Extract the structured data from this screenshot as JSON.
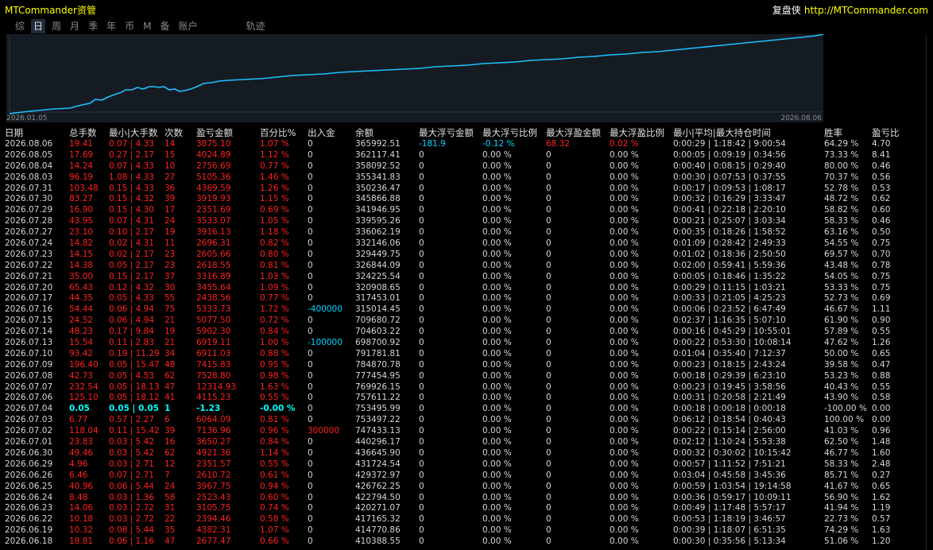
{
  "app_title": "MTCommander资管",
  "brand": {
    "name": "复盘侠",
    "url": "http://MTCommander.com"
  },
  "tabs": [
    "综",
    "日",
    "周",
    "月",
    "季",
    "年",
    "币",
    "M",
    "备",
    "账户",
    "轨迹"
  ],
  "active_tab": "日",
  "equity_chart": {
    "start_label": "2026.01.05",
    "end_label": "2026.08.06",
    "line_color": "#1ec0ff",
    "background": "#151b22"
  },
  "columns": [
    "日期",
    "总手数",
    "最小|大手数",
    "次数",
    "盈亏金额",
    "百分比%",
    "出入金",
    "余额",
    "最大浮亏金额",
    "最大浮亏比例",
    "最大浮盈金额",
    "最大浮盈比例",
    "最小|平均|最大持仓时间",
    "胜率",
    "盈亏比"
  ],
  "rows": [
    [
      "2026.08.06",
      "19.41",
      "0.07 | 4.33",
      "14",
      "3875.10",
      "1.07 %",
      "0",
      "365992.51",
      "-181.9",
      "-0.12 %",
      "68.32",
      "0.02 %",
      "0:00:29 | 1:18:42 | 9:00:54",
      "64.29 %",
      "4.70"
    ],
    [
      "2026.08.05",
      "17.69",
      "0.27 | 2.17",
      "15",
      "4024.89",
      "1.12 %",
      "0",
      "362117.41",
      "0",
      "0.00 %",
      "0",
      "0.00 %",
      "0:00:05 | 0:09:19 | 0:34:56",
      "73.33 %",
      "8.41"
    ],
    [
      "2026.08.04",
      "14.24",
      "0.07 | 4.33",
      "10",
      "2756.69",
      "0.77 %",
      "0",
      "358092.52",
      "0",
      "0.00 %",
      "0",
      "0.00 %",
      "0:00:40 | 0:08:15 | 0:29:40",
      "80.00 %",
      "0.46"
    ],
    [
      "2026.08.03",
      "96.19",
      "1.08 | 4.33",
      "27",
      "5105.36",
      "1.46 %",
      "0",
      "355341.83",
      "0",
      "0.00 %",
      "0",
      "0.00 %",
      "0:00:30 | 0:07:53 | 0:37:55",
      "70.37 %",
      "0.56"
    ],
    [
      "2026.07.31",
      "103.48",
      "0.15 | 4.33",
      "36",
      "4369.59",
      "1.26 %",
      "0",
      "350236.47",
      "0",
      "0.00 %",
      "0",
      "0.00 %",
      "0:00:17 | 0:09:53 | 1:08:17",
      "52.78 %",
      "0.53"
    ],
    [
      "2026.07.30",
      "83.27",
      "0.15 | 4.32",
      "39",
      "3919.93",
      "1.15 %",
      "0",
      "345866.88",
      "0",
      "0.00 %",
      "0",
      "0.00 %",
      "0:00:32 | 0:16:29 | 3:33:47",
      "48.72 %",
      "0.62"
    ],
    [
      "2026.07.29",
      "16.90",
      "0.15 | 4.30",
      "17",
      "2351.69",
      "0.69 %",
      "0",
      "341946.95",
      "0",
      "0.00 %",
      "0",
      "0.00 %",
      "0:00:41 | 0:22:18 | 2:20:10",
      "58.82 %",
      "0.60"
    ],
    [
      "2026.07.28",
      "43.95",
      "0.07 | 4.31",
      "24",
      "3533.07",
      "1.05 %",
      "0",
      "339595.26",
      "0",
      "0.00 %",
      "0",
      "0.00 %",
      "0:00:21 | 0:25:07 | 3:03:34",
      "58.33 %",
      "0.46"
    ],
    [
      "2026.07.27",
      "23.10",
      "0.10 | 2.17",
      "19",
      "3916.13",
      "1.18 %",
      "0",
      "336062.19",
      "0",
      "0.00 %",
      "0",
      "0.00 %",
      "0:00:35 | 0:18:26 | 1:58:52",
      "63.16 %",
      "0.50"
    ],
    [
      "2026.07.24",
      "14.82",
      "0.02 | 4.31",
      "11",
      "2696.31",
      "0.82 %",
      "0",
      "332146.06",
      "0",
      "0.00 %",
      "0",
      "0.00 %",
      "0:01:09 | 0:28:42 | 2:49:33",
      "54.55 %",
      "0.75"
    ],
    [
      "2026.07.23",
      "14.15",
      "0.02 | 2.17",
      "23",
      "2605.66",
      "0.80 %",
      "0",
      "329449.75",
      "0",
      "0.00 %",
      "0",
      "0.00 %",
      "0:01:02 | 0:18:36 | 2:50:50",
      "69.57 %",
      "0.70"
    ],
    [
      "2026.07.22",
      "14.38",
      "0.05 | 2.17",
      "23",
      "2618.55",
      "0.81 %",
      "0",
      "326844.09",
      "0",
      "0.00 %",
      "0",
      "0.00 %",
      "0:02:00 | 0:59:41 | 5:59:36",
      "43.48 %",
      "0.78"
    ],
    [
      "2026.07.21",
      "35.00",
      "0.15 | 2.17",
      "37",
      "3316.89",
      "1.03 %",
      "0",
      "324225.54",
      "0",
      "0.00 %",
      "0",
      "0.00 %",
      "0:00:05 | 0:18:46 | 1:35:22",
      "54.05 %",
      "0.75"
    ],
    [
      "2026.07.20",
      "65.43",
      "0.12 | 4.32",
      "30",
      "3455.64",
      "1.09 %",
      "0",
      "320908.65",
      "0",
      "0.00 %",
      "0",
      "0.00 %",
      "0:00:29 | 0:11:15 | 1:03:21",
      "53.33 %",
      "0.75"
    ],
    [
      "2026.07.17",
      "44.35",
      "0.05 | 4.33",
      "55",
      "2438.56",
      "0.77 %",
      "0",
      "317453.01",
      "0",
      "0.00 %",
      "0",
      "0.00 %",
      "0:00:33 | 0:21:05 | 4:25:23",
      "52.73 %",
      "0.69"
    ],
    [
      "2026.07.16",
      "54.44",
      "0.06 | 4.94",
      "75",
      "5333.73",
      "1.72 %",
      "-400000",
      "315014.45",
      "0",
      "0.00 %",
      "0",
      "0.00 %",
      "0:00:06 | 0:23:52 | 6:47:49",
      "46.67 %",
      "1.11"
    ],
    [
      "2026.07.15",
      "24.52",
      "0.06 | 4.94",
      "21",
      "5077.50",
      "0.72 %",
      "0",
      "709680.72",
      "0",
      "0.00 %",
      "0",
      "0.00 %",
      "0:02:37 | 1:16:35 | 5:07:10",
      "61.90 %",
      "0.90"
    ],
    [
      "2026.07.14",
      "48.23",
      "0.17 | 9.84",
      "19",
      "5902.30",
      "0.84 %",
      "0",
      "704603.22",
      "0",
      "0.00 %",
      "0",
      "0.00 %",
      "0:00:16 | 0:45:29 | 10:55:01",
      "57.89 %",
      "0.55"
    ],
    [
      "2026.07.13",
      "15.54",
      "0.11 | 2.83",
      "21",
      "6919.11",
      "1.00 %",
      "-100000",
      "698700.92",
      "0",
      "0.00 %",
      "0",
      "0.00 %",
      "0:00:22 | 0:53:30 | 10:08:14",
      "47.62 %",
      "1.26"
    ],
    [
      "2026.07.10",
      "93.42",
      "0.19 | 11.29",
      "34",
      "6911.03",
      "0.88 %",
      "0",
      "791781.81",
      "0",
      "0.00 %",
      "0",
      "0.00 %",
      "0:01:04 | 0:35:40 | 7:12:37",
      "50.00 %",
      "0.65"
    ],
    [
      "2026.07.09",
      "196.40",
      "0.05 | 15.47",
      "48",
      "7415.83",
      "0.95 %",
      "0",
      "784870.78",
      "0",
      "0.00 %",
      "0",
      "0.00 %",
      "0:00:23 | 0:18:15 | 2:43:24",
      "39.58 %",
      "0.47"
    ],
    [
      "2026.07.08",
      "42.73",
      "0.05 | 4.53",
      "62",
      "7528.80",
      "0.98 %",
      "0",
      "777454.95",
      "0",
      "0.00 %",
      "0",
      "0.00 %",
      "0:00:18 | 0:29:39 | 6:23:10",
      "53.23 %",
      "0.88"
    ],
    [
      "2026.07.07",
      "232.54",
      "0.05 | 18.13",
      "47",
      "12314.93",
      "1.63 %",
      "0",
      "769926.15",
      "0",
      "0.00 %",
      "0",
      "0.00 %",
      "0:00:23 | 0:19:45 | 3:58:56",
      "40.43 %",
      "0.55"
    ],
    [
      "2026.07.06",
      "125.10",
      "0.05 | 18.12",
      "41",
      "4115.23",
      "0.55 %",
      "0",
      "757611.22",
      "0",
      "0.00 %",
      "0",
      "0.00 %",
      "0:00:31 | 0:20:58 | 2:21:49",
      "43.90 %",
      "0.58"
    ],
    [
      "2026.07.04",
      "0.05",
      "0.05 | 0.05",
      "1",
      "-1.23",
      "-0.00 %",
      "0",
      "753495.99",
      "0",
      "0.00 %",
      "0",
      "0.00 %",
      "0:00:18 | 0:00:18 | 0:00:18",
      "-100.00 %",
      "0.00"
    ],
    [
      "2026.07.03",
      "6.77",
      "0.57 | 2.27",
      "6",
      "6064.09",
      "0.81 %",
      "0",
      "753497.22",
      "0",
      "0.00 %",
      "0",
      "0.00 %",
      "0:06:12 | 0:18:54 | 0:40:43",
      "100.00 %",
      "0.00"
    ],
    [
      "2026.07.02",
      "118.04",
      "0.11 | 15.42",
      "39",
      "7136.96",
      "0.96 %",
      "300000",
      "747433.13",
      "0",
      "0.00 %",
      "0",
      "0.00 %",
      "0:00:22 | 0:15:14 | 2:56:00",
      "41.03 %",
      "0.96"
    ],
    [
      "2026.07.01",
      "23.83",
      "0.03 | 5.42",
      "16",
      "3650.27",
      "0.84 %",
      "0",
      "440296.17",
      "0",
      "0.00 %",
      "0",
      "0.00 %",
      "0:02:12 | 1:10:24 | 5:53:38",
      "62.50 %",
      "1.48"
    ],
    [
      "2026.06.30",
      "49.46",
      "0.03 | 5.42",
      "62",
      "4921.36",
      "1.14 %",
      "0",
      "436645.90",
      "0",
      "0.00 %",
      "0",
      "0.00 %",
      "0:00:32 | 0:30:02 | 10:15:42",
      "46.77 %",
      "1.60"
    ],
    [
      "2026.06.29",
      "4.96",
      "0.03 | 2.71",
      "12",
      "2351.57",
      "0.55 %",
      "0",
      "431724.54",
      "0",
      "0.00 %",
      "0",
      "0.00 %",
      "0:00:57 | 1:11:52 | 7:51:21",
      "58.33 %",
      "2.48"
    ],
    [
      "2026.06.26",
      "6.46",
      "0.07 | 2.71",
      "7",
      "2610.72",
      "0.61 %",
      "0",
      "429372.97",
      "0",
      "0.00 %",
      "0",
      "0.00 %",
      "0:03:04 | 0:45:58 | 3:45:36",
      "85.71 %",
      "0.27"
    ],
    [
      "2026.06.25",
      "40.96",
      "0.06 | 5.44",
      "24",
      "3967.75",
      "0.94 %",
      "0",
      "426762.25",
      "0",
      "0.00 %",
      "0",
      "0.00 %",
      "0:00:59 | 1:03:54 | 19:14:58",
      "41.67 %",
      "0.65"
    ],
    [
      "2026.06.24",
      "8.48",
      "0.03 | 1.36",
      "58",
      "2523.43",
      "0.60 %",
      "0",
      "422794.50",
      "0",
      "0.00 %",
      "0",
      "0.00 %",
      "0:00:36 | 0:59:17 | 10:09:11",
      "56.90 %",
      "1.62"
    ],
    [
      "2026.06.23",
      "14.06",
      "0.03 | 2.72",
      "31",
      "3105.75",
      "0.74 %",
      "0",
      "420271.07",
      "0",
      "0.00 %",
      "0",
      "0.00 %",
      "0:00:49 | 1:17:48 | 5:57:17",
      "41.94 %",
      "1.19"
    ],
    [
      "2026.06.22",
      "10.18",
      "0.03 | 2.72",
      "22",
      "2394.46",
      "0.58 %",
      "0",
      "417165.32",
      "0",
      "0.00 %",
      "0",
      "0.00 %",
      "0:00:53 | 1:18:19 | 3:46:57",
      "22.73 %",
      "0.57"
    ],
    [
      "2026.06.19",
      "10.32",
      "0.08 | 5.44",
      "35",
      "4382.31",
      "1.07 %",
      "0",
      "414770.86",
      "0",
      "0.00 %",
      "0",
      "0.00 %",
      "0:00:39 | 1:18:07 | 6:51:35",
      "74.29 %",
      "1.63"
    ],
    [
      "2026.06.18",
      "18.81",
      "0.06 | 1.16",
      "47",
      "2677.47",
      "0.66 %",
      "0",
      "410388.55",
      "0",
      "0.00 %",
      "0",
      "0.00 %",
      "0:00:30 | 0:35:56 | 5:13:34",
      "51.06 %",
      "1.20"
    ]
  ],
  "colors": {
    "header": "#e0e0e0",
    "text": "#d6d6d6",
    "positive": "#ff2020",
    "negative": "#00d8ff",
    "highlight": "#00ffff"
  }
}
